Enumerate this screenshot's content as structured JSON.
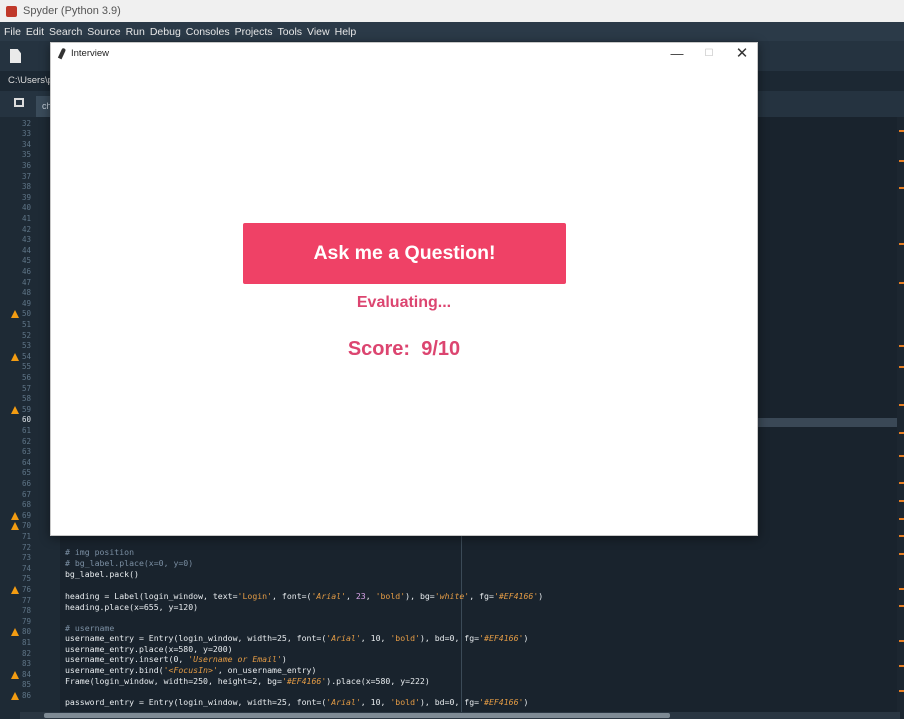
{
  "spyder": {
    "title": "Spyder (Python 3.9)",
    "menu": [
      "File",
      "Edit",
      "Search",
      "Source",
      "Run",
      "Debug",
      "Consoles",
      "Projects",
      "Tools",
      "View",
      "Help"
    ],
    "path_partial": "C:\\Users\\p",
    "tab_partial": "ch",
    "line_numbers": [
      "32",
      "33",
      "34",
      "35",
      "36",
      "37",
      "38",
      "39",
      "40",
      "41",
      "42",
      "43",
      "44",
      "45",
      "46",
      "47",
      "48",
      "49",
      "50",
      "51",
      "52",
      "53",
      "54",
      "55",
      "56",
      "57",
      "58",
      "59",
      "60",
      "61",
      "62",
      "63",
      "64",
      "65",
      "66",
      "67",
      "68",
      "69",
      "70",
      "71",
      "72",
      "73",
      "74",
      "75",
      "76",
      "77",
      "78",
      "79",
      "80",
      "81",
      "82",
      "83",
      "84",
      "85",
      "86"
    ],
    "current_line": "60",
    "warning_lines": [
      "50",
      "54",
      "59",
      "69",
      "70",
      "76",
      "80",
      "84",
      "86"
    ]
  },
  "code": {
    "l72": "# img position",
    "l73": "# bg_label.place(x=0, y=0)",
    "l74": "bg_label.pack()",
    "l76_a": "heading = Label(login_window, text=",
    "l76_b": "'Login'",
    "l76_c": ", font=(",
    "l76_d": "'Arial'",
    "l76_e": ", ",
    "l76_f": "23",
    "l76_g": ", ",
    "l76_h": "'bold'",
    "l76_i": "), bg=",
    "l76_j": "'white'",
    "l76_k": ", fg=",
    "l76_l": "'#EF4166'",
    "l76_m": ")",
    "l77": "heading.place(x=655, y=120)",
    "l79": "# username",
    "l80_a": "username_entry = Entry(login_window, width=25, font=(",
    "l80_b": "'Arial'",
    "l80_c": ", 10, ",
    "l80_d": "'bold'",
    "l80_e": "), bd=0, fg=",
    "l80_f": "'#EF4166'",
    "l80_g": ")",
    "l81": "username_entry.place(x=580, y=200)",
    "l82_a": "username_entry.insert(0, ",
    "l82_b": "'Username or Email'",
    "l82_c": ")",
    "l83_a": "username_entry.bind(",
    "l83_b": "'<FocusIn>'",
    "l83_c": ", on_username_entry)",
    "l84_a": "Frame(login_window, width=250, height=2, bg=",
    "l84_b": "'#EF4166'",
    "l84_c": ").place(x=580, y=222)",
    "l86_a": "password_entry = Entry(login_window, width=25, font=(",
    "l86_b": "'Arial'",
    "l86_c": ", 10, ",
    "l86_d": "'bold'",
    "l86_e": "), bd=0, fg=",
    "l86_f": "'#EF4166'",
    "l86_g": ")"
  },
  "dialog": {
    "title": "Interview",
    "minimize_glyph": "—",
    "maximize_glyph": "☐",
    "close_glyph": "✕",
    "ask_button": "Ask me a Question!",
    "status": "Evaluating...",
    "score": "Score:  9/10",
    "accent_color": "#EF4166"
  }
}
